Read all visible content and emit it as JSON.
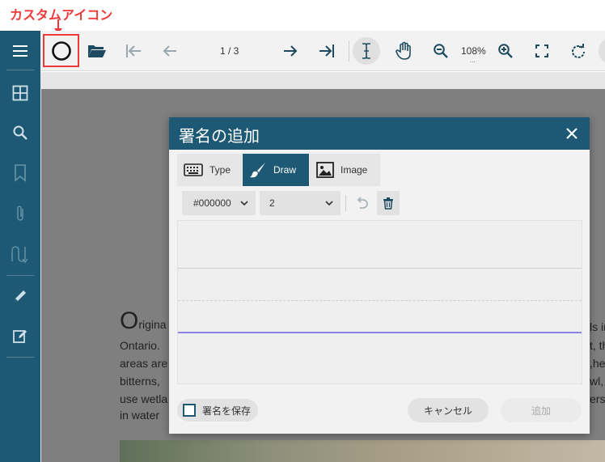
{
  "annotation": {
    "label": "カスタムアイコン"
  },
  "toolbar": {
    "page_indicator": "1 / 3",
    "zoom_level": "108%",
    "zoom_more": "..."
  },
  "document": {
    "drop_cap": "O",
    "lines": [
      {
        "left": "rigina",
        "right": "ls in"
      },
      {
        "left": "Ontario.",
        "right": "t, th"
      },
      {
        "left": "areas are",
        "right": ",he"
      },
      {
        "left": "bitterns,",
        "right": "wl,"
      },
      {
        "left": "use wetla",
        "right": "ers"
      },
      {
        "left": "in water",
        "right": ""
      }
    ]
  },
  "dialog": {
    "title": "署名の追加",
    "tabs": [
      {
        "label": "Type",
        "icon": "keyboard-icon"
      },
      {
        "label": "Draw",
        "icon": "brush-icon"
      },
      {
        "label": "Image",
        "icon": "image-icon"
      }
    ],
    "color_value": "#000000",
    "width_value": "2",
    "save_signature_label": "署名を保存",
    "cancel_label": "キャンセル",
    "add_label": "追加"
  },
  "colors": {
    "sidebar": "#1d5974",
    "header": "#1d5974",
    "annotation": "#ee3a3a",
    "baseline": "#8a84e6"
  }
}
